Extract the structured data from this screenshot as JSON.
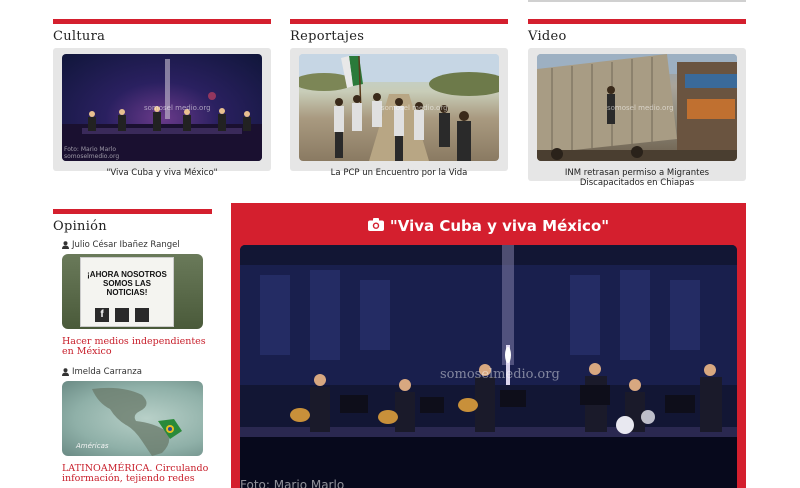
{
  "sections": [
    {
      "title": "Cultura",
      "caption": "\"Viva Cuba y viva México\"",
      "watermark": "somosel medio.org",
      "credit": "Foto: Mario Marlo\nsomoselmedio.org"
    },
    {
      "title": "Reportajes",
      "caption": "La PCP un Encuentro por la Vida",
      "watermark": "somosel medio.org"
    },
    {
      "title": "Video",
      "caption": "INM retrasan permiso a Migrantes Discapacitados en Chiapas",
      "watermark": "somosel medio.org"
    }
  ],
  "opinion": {
    "title": "Opinión",
    "items": [
      {
        "author": "Julio César Ibañez Rangel",
        "sign_text": "¡AHORA NOSOTROS SOMOS LAS NOTICIAS!",
        "link": "Hacer medios independientes en México"
      },
      {
        "author": "Imelda Carranza",
        "map_text": "Américas",
        "link": "LATINOAMÉRICA. Circulando información, tejiendo redes"
      }
    ]
  },
  "feature": {
    "title": "\"Viva Cuba y viva México\"",
    "watermark": "somoselmedio.org",
    "credit": "Foto: Mario Marlo"
  },
  "colors": {
    "accent": "#d41f2e",
    "card_bg": "#e6e6e6"
  }
}
